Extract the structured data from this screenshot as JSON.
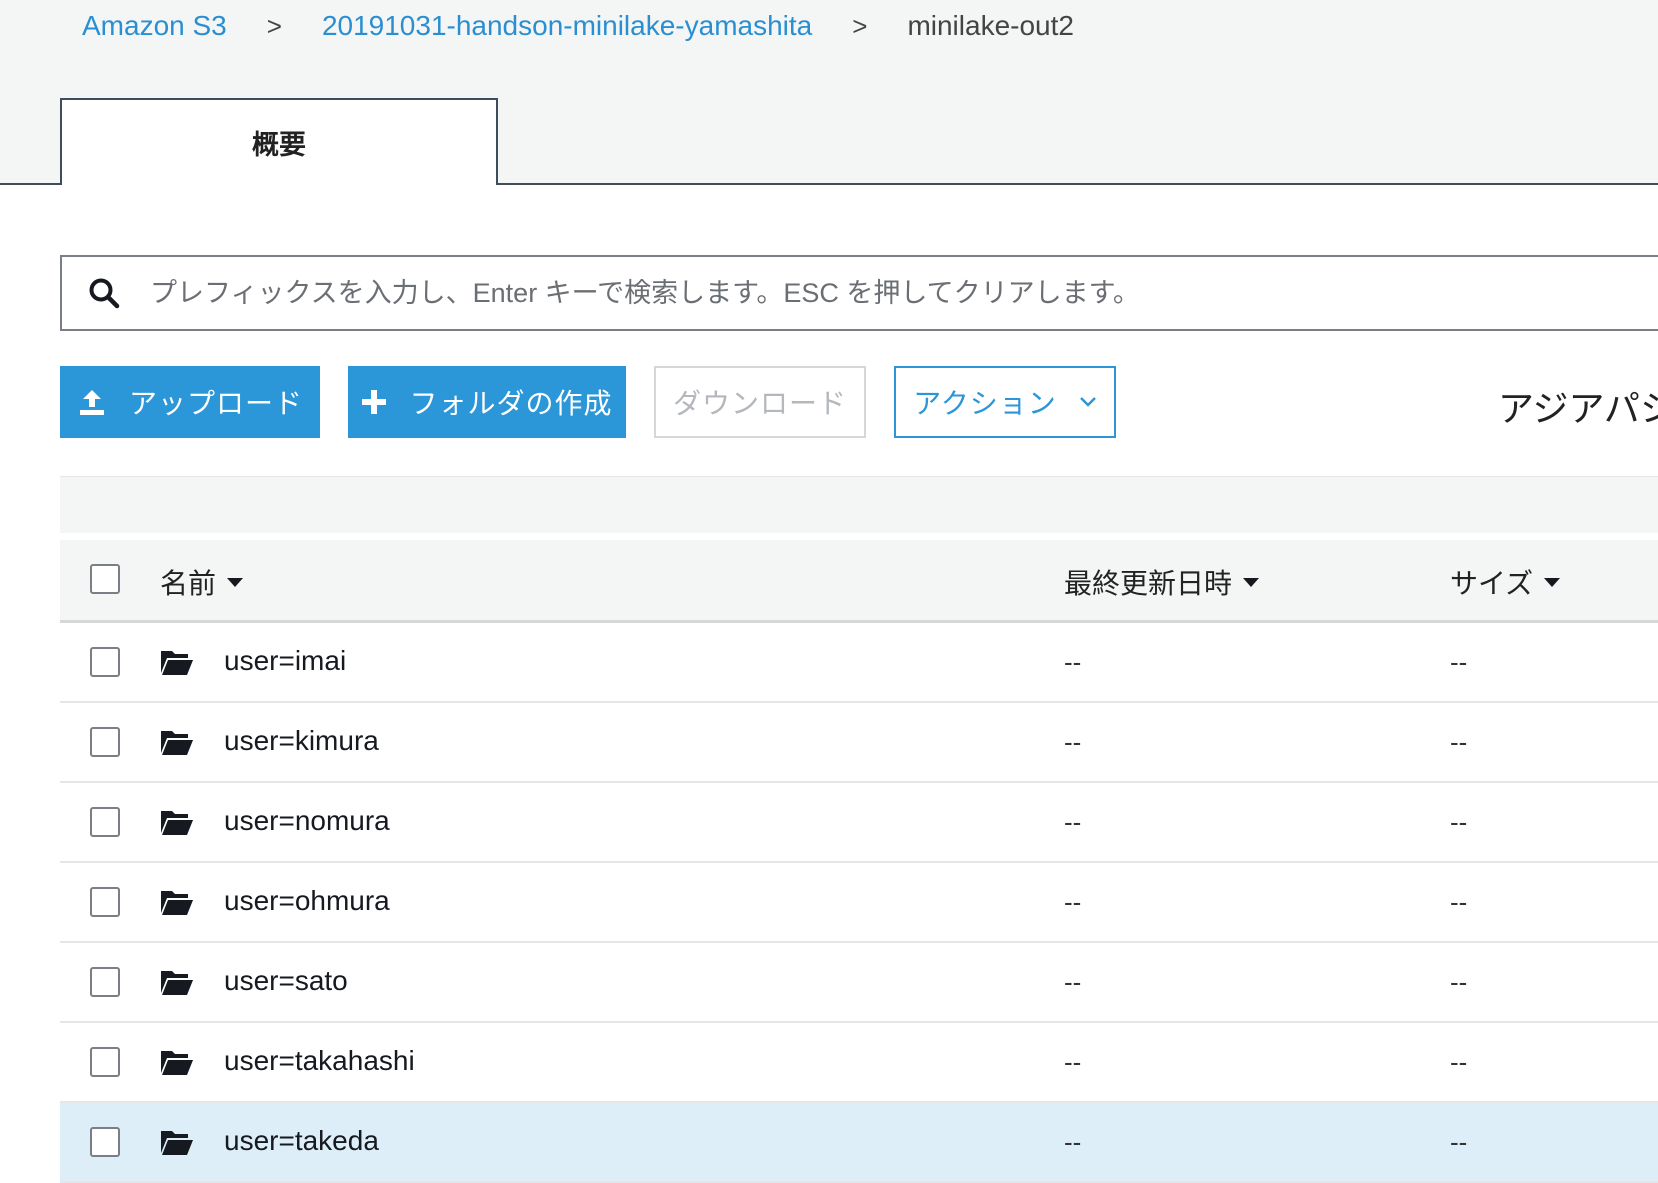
{
  "breadcrumb": {
    "root": "Amazon S3",
    "bucket": "20191031-handson-minilake-yamashita",
    "current": "minilake-out2"
  },
  "tabs": [
    {
      "label": "概要"
    }
  ],
  "search": {
    "placeholder": "プレフィックスを入力し、Enter キーで検索します。ESC を押してクリアします。",
    "value": ""
  },
  "toolbar": {
    "upload_label": "アップロード",
    "create_folder_label": "フォルダの作成",
    "download_label": "ダウンロード",
    "actions_label": "アクション",
    "region_label": "アジアパシ"
  },
  "table": {
    "columns": {
      "name": "名前",
      "last_modified": "最終更新日時",
      "size": "サイズ"
    },
    "rows": [
      {
        "name": "user=imai",
        "last_modified": "--",
        "size": "--"
      },
      {
        "name": "user=kimura",
        "last_modified": "--",
        "size": "--"
      },
      {
        "name": "user=nomura",
        "last_modified": "--",
        "size": "--"
      },
      {
        "name": "user=ohmura",
        "last_modified": "--",
        "size": "--"
      },
      {
        "name": "user=sato",
        "last_modified": "--",
        "size": "--"
      },
      {
        "name": "user=takahashi",
        "last_modified": "--",
        "size": "--"
      },
      {
        "name": "user=takeda",
        "last_modified": "--",
        "size": "--"
      }
    ]
  },
  "colors": {
    "link": "#2a8fd1",
    "primary_button": "#2b96d8",
    "selected_row": "#ddeef8",
    "header_bg": "#f4f5f5"
  }
}
